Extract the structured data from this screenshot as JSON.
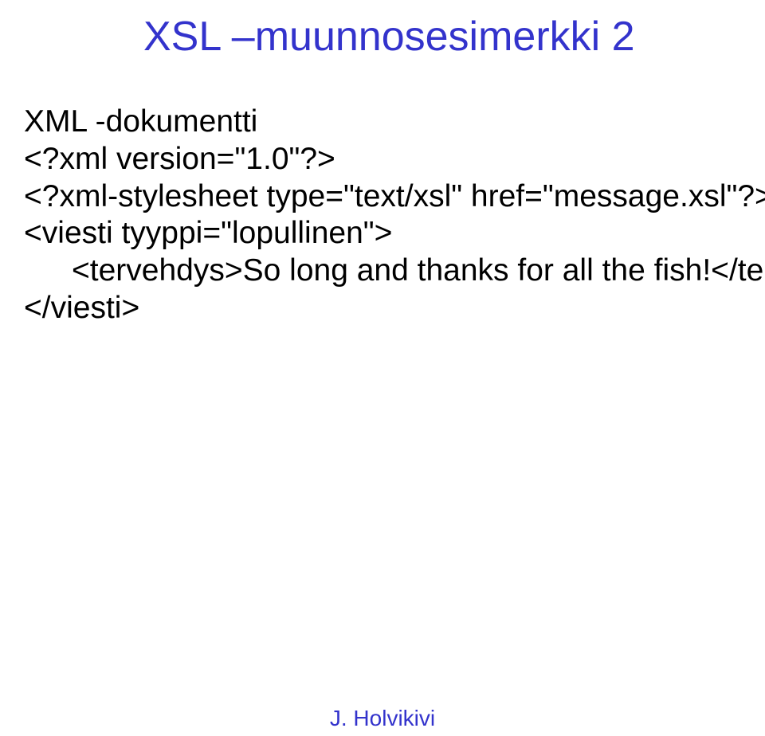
{
  "title": "XSL –muunnosesimerkki 2",
  "lines": {
    "l1": "XML -dokumentti",
    "l2": "<?xml version=\"1.0\"?>",
    "l3": "<?xml-stylesheet type=\"text/xsl\" href=\"message.xsl\"?>",
    "l4": "<viesti tyyppi=\"lopullinen\">",
    "l5": "<tervehdys>So long and thanks for all the fish!</tervehdys>",
    "l6": "</viesti>"
  },
  "footer": "J. Holvikivi"
}
